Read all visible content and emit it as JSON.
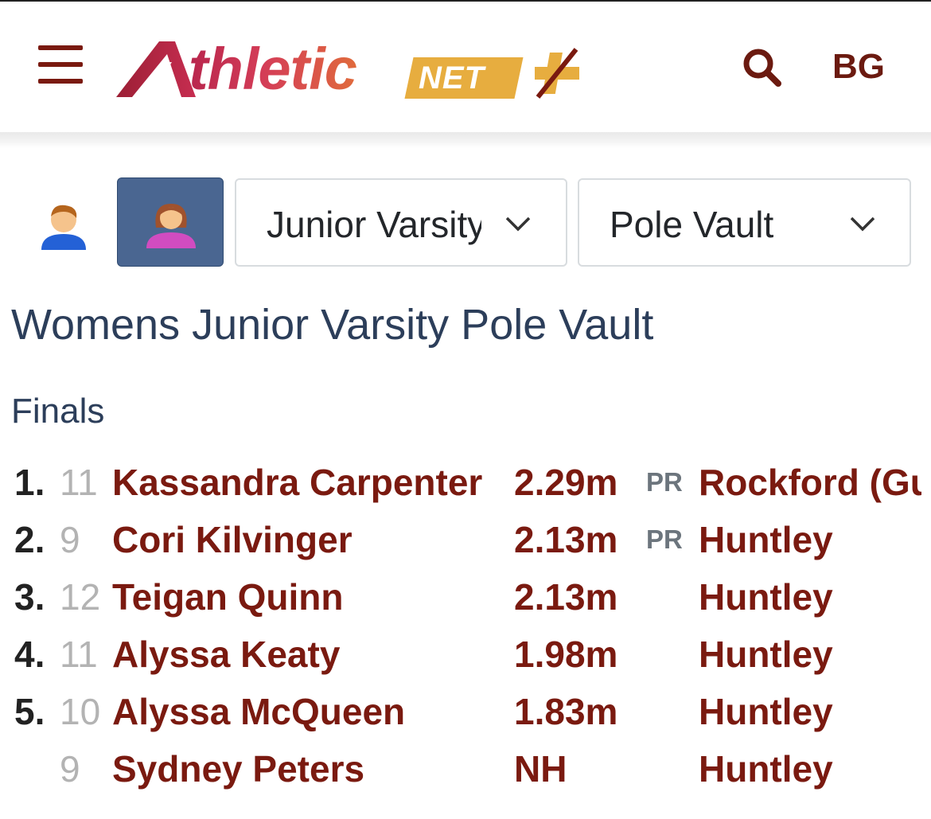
{
  "header": {
    "logo_text": "thletic",
    "logo_net": "NET",
    "user_initials": "BG"
  },
  "filters": {
    "gender_male_icon": "male-person-icon",
    "gender_female_icon": "female-person-icon",
    "gender_selected": "female",
    "division": "Junior Varsity",
    "event": "Pole Vault"
  },
  "page_title": "Womens Junior Varsity Pole Vault",
  "section_title": "Finals",
  "results": [
    {
      "place": "1.",
      "grade": "11",
      "athlete": "Kassandra Carpenter",
      "mark": "2.29m",
      "pr": "PR",
      "team": "Rockford (Gu"
    },
    {
      "place": "2.",
      "grade": "9",
      "athlete": "Cori Kilvinger",
      "mark": "2.13m",
      "pr": "PR",
      "team": "Huntley"
    },
    {
      "place": "3.",
      "grade": "12",
      "athlete": "Teigan Quinn",
      "mark": "2.13m",
      "pr": "",
      "team": "Huntley"
    },
    {
      "place": "4.",
      "grade": "11",
      "athlete": "Alyssa Keaty",
      "mark": "1.98m",
      "pr": "",
      "team": "Huntley"
    },
    {
      "place": "5.",
      "grade": "10",
      "athlete": "Alyssa McQueen",
      "mark": "1.83m",
      "pr": "",
      "team": "Huntley"
    },
    {
      "place": "",
      "grade": "9",
      "athlete": "Sydney Peters",
      "mark": "NH",
      "pr": "",
      "team": "Huntley"
    }
  ],
  "colors": {
    "brand_maroon": "#7a1a10",
    "selected_toggle": "#4a6691",
    "title_navy": "#2c3e5a",
    "logo_gold": "#e7ad3f"
  }
}
